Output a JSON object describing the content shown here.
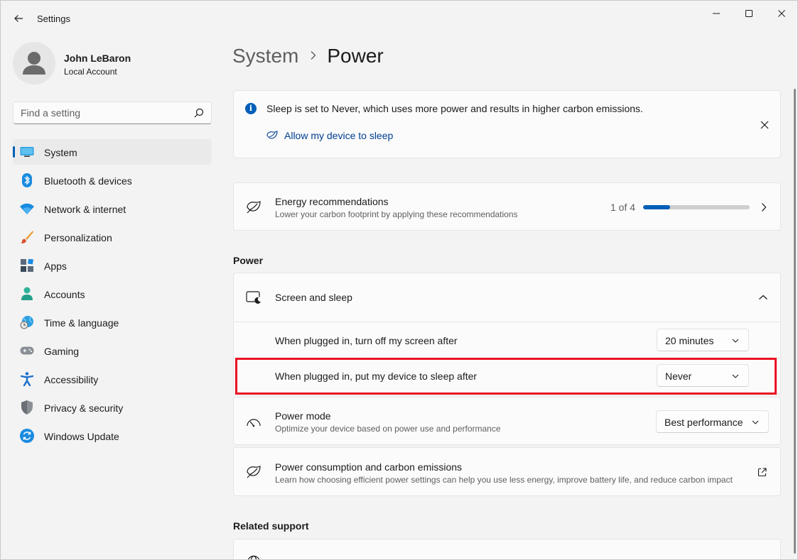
{
  "window": {
    "app_title": "Settings"
  },
  "user": {
    "name": "John LeBaron",
    "account_type": "Local Account"
  },
  "search": {
    "placeholder": "Find a setting"
  },
  "sidebar": {
    "items": [
      {
        "label": "System",
        "icon": "monitor-icon",
        "active": true
      },
      {
        "label": "Bluetooth & devices",
        "icon": "bluetooth-icon"
      },
      {
        "label": "Network & internet",
        "icon": "wifi-icon"
      },
      {
        "label": "Personalization",
        "icon": "brush-icon"
      },
      {
        "label": "Apps",
        "icon": "apps-icon"
      },
      {
        "label": "Accounts",
        "icon": "person-icon"
      },
      {
        "label": "Time & language",
        "icon": "globe-clock-icon"
      },
      {
        "label": "Gaming",
        "icon": "gamepad-icon"
      },
      {
        "label": "Accessibility",
        "icon": "accessibility-icon"
      },
      {
        "label": "Privacy & security",
        "icon": "shield-icon"
      },
      {
        "label": "Windows Update",
        "icon": "update-icon"
      }
    ]
  },
  "breadcrumb": {
    "parent": "System",
    "current": "Power"
  },
  "info_banner": {
    "text": "Sleep is set to Never, which uses more power and results in higher carbon emissions.",
    "link_label": "Allow my device to sleep"
  },
  "energy": {
    "title": "Energy recommendations",
    "subtitle": "Lower your carbon footprint by applying these recommendations",
    "progress_label": "1 of 4",
    "progress_fraction": 0.25
  },
  "power_section": {
    "heading": "Power",
    "screen_sleep": {
      "title": "Screen and sleep",
      "rows": [
        {
          "label": "When plugged in, turn off my screen after",
          "value": "20 minutes"
        },
        {
          "label": "When plugged in, put my device to sleep after",
          "value": "Never"
        }
      ]
    },
    "power_mode": {
      "title": "Power mode",
      "subtitle": "Optimize your device based on power use and performance",
      "value": "Best performance"
    },
    "consumption": {
      "title": "Power consumption and carbon emissions",
      "subtitle": "Learn how choosing efficient power settings can help you use less energy, improve battery life, and reduce carbon impact"
    }
  },
  "related_support": {
    "heading": "Related support"
  },
  "colors": {
    "accent": "#005fb8",
    "highlight": "#e81123"
  }
}
